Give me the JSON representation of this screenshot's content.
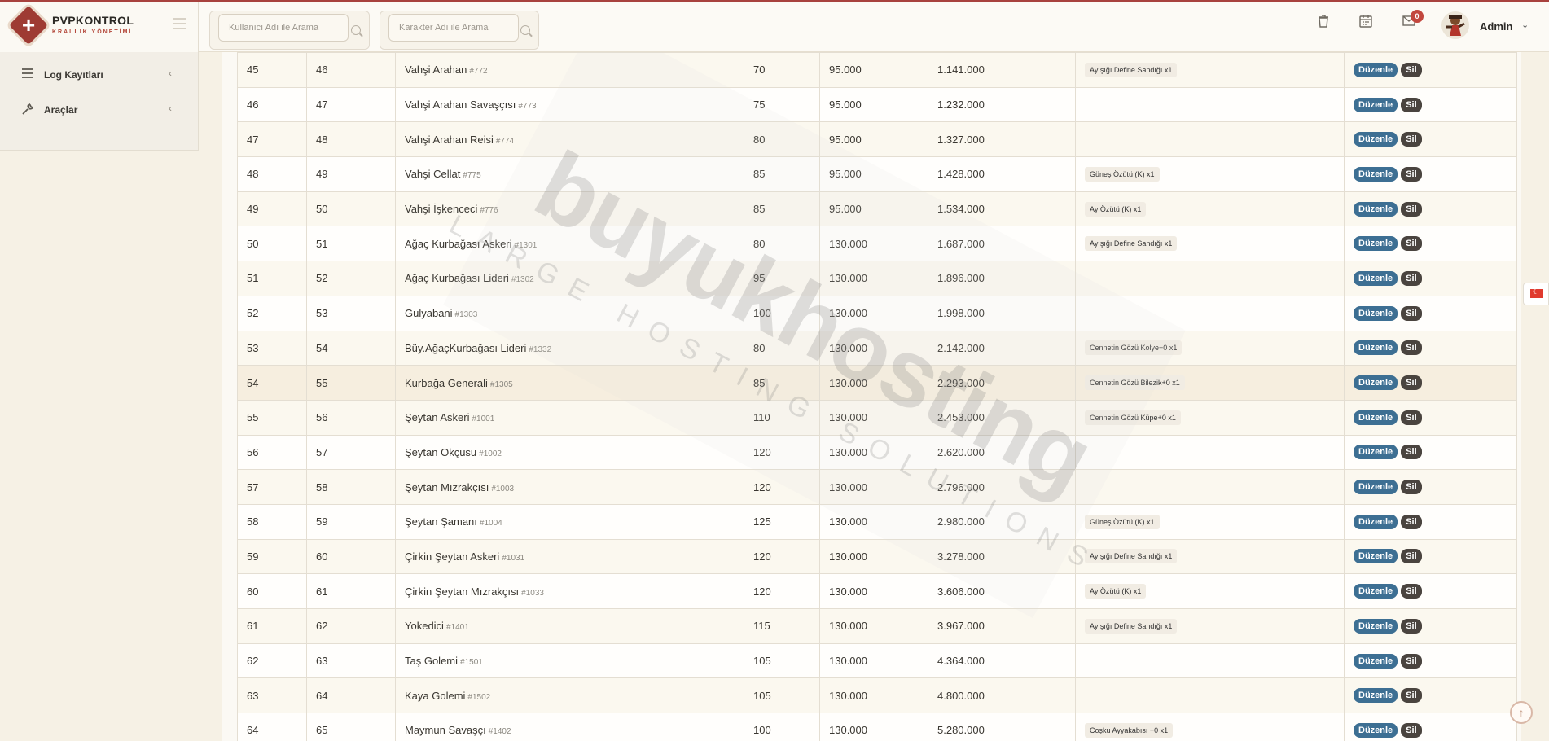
{
  "brand": {
    "title": "PVPKONTROL",
    "subtitle": "KRALLIK YÖNETİMİ"
  },
  "search": {
    "user_placeholder": "Kullanıcı Adı ile Arama",
    "character_placeholder": "Karakter Adı ile Arama"
  },
  "header": {
    "notification_count": "0",
    "admin_name": "Admin"
  },
  "sidebar": {
    "items": [
      {
        "label": "Log Kayıtları",
        "icon": "list-icon"
      },
      {
        "label": "Araçlar",
        "icon": "wrench-icon"
      }
    ]
  },
  "actions": {
    "edit_label": "Düzenle",
    "delete_label": "Sil"
  },
  "watermark": {
    "main": "buyukhosting",
    "sub": "LARGE HOSTING SOLUTIONS"
  },
  "table": {
    "rows": [
      {
        "idx": "45",
        "num": "46",
        "name": "Vahşi Arahan",
        "code": "#772",
        "level": "70",
        "value": "95.000",
        "exp": "1.141.000",
        "item": "Ayışığı Define Sandığı x1"
      },
      {
        "idx": "46",
        "num": "47",
        "name": "Vahşi Arahan Savaşçısı",
        "code": "#773",
        "level": "75",
        "value": "95.000",
        "exp": "1.232.000",
        "item": ""
      },
      {
        "idx": "47",
        "num": "48",
        "name": "Vahşi Arahan Reisi",
        "code": "#774",
        "level": "80",
        "value": "95.000",
        "exp": "1.327.000",
        "item": ""
      },
      {
        "idx": "48",
        "num": "49",
        "name": "Vahşi Cellat",
        "code": "#775",
        "level": "85",
        "value": "95.000",
        "exp": "1.428.000",
        "item": "Güneş Özütü (K) x1"
      },
      {
        "idx": "49",
        "num": "50",
        "name": "Vahşi İşkenceci",
        "code": "#776",
        "level": "85",
        "value": "95.000",
        "exp": "1.534.000",
        "item": "Ay Özütü (K) x1"
      },
      {
        "idx": "50",
        "num": "51",
        "name": "Ağaç Kurbağası Askeri",
        "code": "#1301",
        "level": "80",
        "value": "130.000",
        "exp": "1.687.000",
        "item": "Ayışığı Define Sandığı x1"
      },
      {
        "idx": "51",
        "num": "52",
        "name": "Ağaç Kurbağası Lideri",
        "code": "#1302",
        "level": "95",
        "value": "130.000",
        "exp": "1.896.000",
        "item": ""
      },
      {
        "idx": "52",
        "num": "53",
        "name": "Gulyabani",
        "code": "#1303",
        "level": "100",
        "value": "130.000",
        "exp": "1.998.000",
        "item": ""
      },
      {
        "idx": "53",
        "num": "54",
        "name": "Büy.AğaçKurbağası Lideri",
        "code": "#1332",
        "level": "80",
        "value": "130.000",
        "exp": "2.142.000",
        "item": "Cennetin Gözü Kolye+0 x1"
      },
      {
        "idx": "54",
        "num": "55",
        "name": "Kurbağa Generali",
        "code": "#1305",
        "level": "85",
        "value": "130.000",
        "exp": "2.293.000",
        "item": "Cennetin Gözü Bilezik+0 x1"
      },
      {
        "idx": "55",
        "num": "56",
        "name": "Şeytan Askeri",
        "code": "#1001",
        "level": "110",
        "value": "130.000",
        "exp": "2.453.000",
        "item": "Cennetin Gözü Küpe+0 x1"
      },
      {
        "idx": "56",
        "num": "57",
        "name": "Şeytan Okçusu",
        "code": "#1002",
        "level": "120",
        "value": "130.000",
        "exp": "2.620.000",
        "item": ""
      },
      {
        "idx": "57",
        "num": "58",
        "name": "Şeytan Mızrakçısı",
        "code": "#1003",
        "level": "120",
        "value": "130.000",
        "exp": "2.796.000",
        "item": ""
      },
      {
        "idx": "58",
        "num": "59",
        "name": "Şeytan Şamanı",
        "code": "#1004",
        "level": "125",
        "value": "130.000",
        "exp": "2.980.000",
        "item": "Güneş Özütü (K) x1"
      },
      {
        "idx": "59",
        "num": "60",
        "name": "Çirkin Şeytan Askeri",
        "code": "#1031",
        "level": "120",
        "value": "130.000",
        "exp": "3.278.000",
        "item": "Ayışığı Define Sandığı x1"
      },
      {
        "idx": "60",
        "num": "61",
        "name": "Çirkin Şeytan Mızrakçısı",
        "code": "#1033",
        "level": "120",
        "value": "130.000",
        "exp": "3.606.000",
        "item": "Ay Özütü (K) x1"
      },
      {
        "idx": "61",
        "num": "62",
        "name": "Yokedici",
        "code": "#1401",
        "level": "115",
        "value": "130.000",
        "exp": "3.967.000",
        "item": "Ayışığı Define Sandığı x1"
      },
      {
        "idx": "62",
        "num": "63",
        "name": "Taş Golemi",
        "code": "#1501",
        "level": "105",
        "value": "130.000",
        "exp": "4.364.000",
        "item": ""
      },
      {
        "idx": "63",
        "num": "64",
        "name": "Kaya Golemi",
        "code": "#1502",
        "level": "105",
        "value": "130.000",
        "exp": "4.800.000",
        "item": ""
      },
      {
        "idx": "64",
        "num": "65",
        "name": "Maymun Savaşçı",
        "code": "#1402",
        "level": "100",
        "value": "130.000",
        "exp": "5.280.000",
        "item": "Coşku Ayyakabısı +0 x1"
      }
    ]
  }
}
